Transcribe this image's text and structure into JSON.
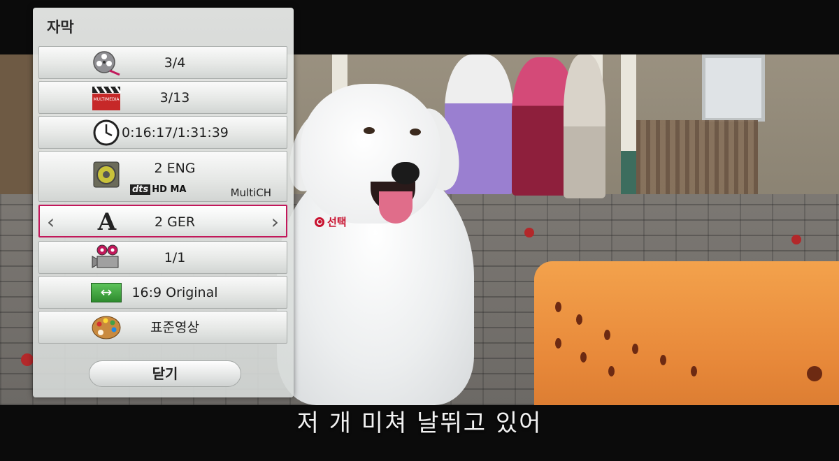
{
  "menu": {
    "title": "자막",
    "rows": [
      {
        "icon": "film-reel-icon",
        "value": "3/4"
      },
      {
        "icon": "clapperboard-icon",
        "value": "3/13",
        "badge": "MULTIMEDIA"
      },
      {
        "icon": "clock-icon",
        "value": "0:16:17/1:31:39"
      },
      {
        "icon": "speaker-icon",
        "value": "2 ENG",
        "codec_brand": "dts",
        "codec": "HD MA",
        "channels": "MultiCH"
      },
      {
        "icon": "letter-a-icon",
        "value": "2 GER",
        "left_arrow": "‹",
        "right_arrow": "›",
        "glyph": "A"
      },
      {
        "icon": "camera-icon",
        "value": "1/1"
      },
      {
        "icon": "aspect-ratio-icon",
        "value": "16:9 Original",
        "glyph": "↔"
      },
      {
        "icon": "palette-icon",
        "value": "표준영상"
      }
    ],
    "close_label": "닫기",
    "active_row": 4,
    "accent_color": "#c2185b"
  },
  "hint": {
    "label": "선택",
    "color": "#c8102e"
  },
  "subtitle": "저 개 미쳐 날뛰고 있어"
}
